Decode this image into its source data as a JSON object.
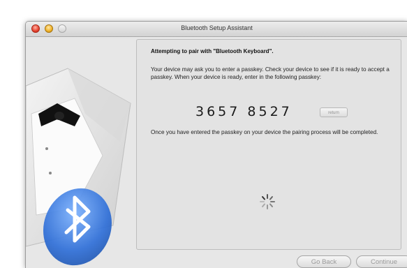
{
  "window": {
    "title": "Bluetooth Setup Assistant"
  },
  "content": {
    "heading": "Attempting to pair with \"Bluetooth Keyboard\".",
    "paragraph1": "Your device may ask you to enter a passkey. Check your device to see if it is ready to accept a passkey. When your device is ready, enter in the following passkey:",
    "passkey": "3657 8527",
    "return_key_label": "return",
    "paragraph2": "Once you have entered the passkey on your device the pairing process will be completed."
  },
  "buttons": {
    "back_label": "Go Back",
    "continue_label": "Continue"
  },
  "icons": {
    "window_close": "close-button-icon",
    "window_minimize": "minimize-button-icon",
    "window_zoom": "zoom-button-icon",
    "sidebar_art": "tuxedo-bluetooth-icon",
    "spinner": "progress-spinner-icon"
  },
  "colors": {
    "bluetooth": "#2f6fd8",
    "window_bg": "#e7e7e7"
  }
}
